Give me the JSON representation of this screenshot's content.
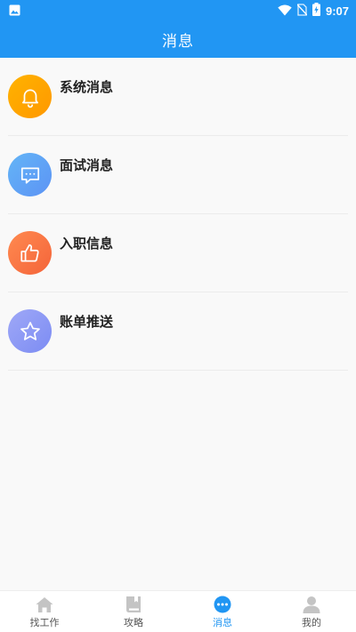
{
  "status_bar": {
    "time": "9:07",
    "icons": [
      "image-icon",
      "wifi-icon",
      "no-sim-icon",
      "battery-charging-icon"
    ]
  },
  "header": {
    "title": "消息"
  },
  "messages": [
    {
      "label": "系统消息",
      "icon": "bell-icon",
      "color": "#ffa000"
    },
    {
      "label": "面试消息",
      "icon": "chat-bubble-icon",
      "color": "#5c9cf5"
    },
    {
      "label": "入职信息",
      "icon": "thumbs-up-icon",
      "color": "#f76b3c"
    },
    {
      "label": "账单推送",
      "icon": "star-icon",
      "color": "#8591f5"
    }
  ],
  "tab_bar": {
    "active_color": "#2196f3",
    "items": [
      {
        "label": "找工作",
        "icon": "home-icon"
      },
      {
        "label": "攻略",
        "icon": "book-icon"
      },
      {
        "label": "消息",
        "icon": "message-dots-icon",
        "active": true
      },
      {
        "label": "我的",
        "icon": "person-icon"
      }
    ]
  }
}
